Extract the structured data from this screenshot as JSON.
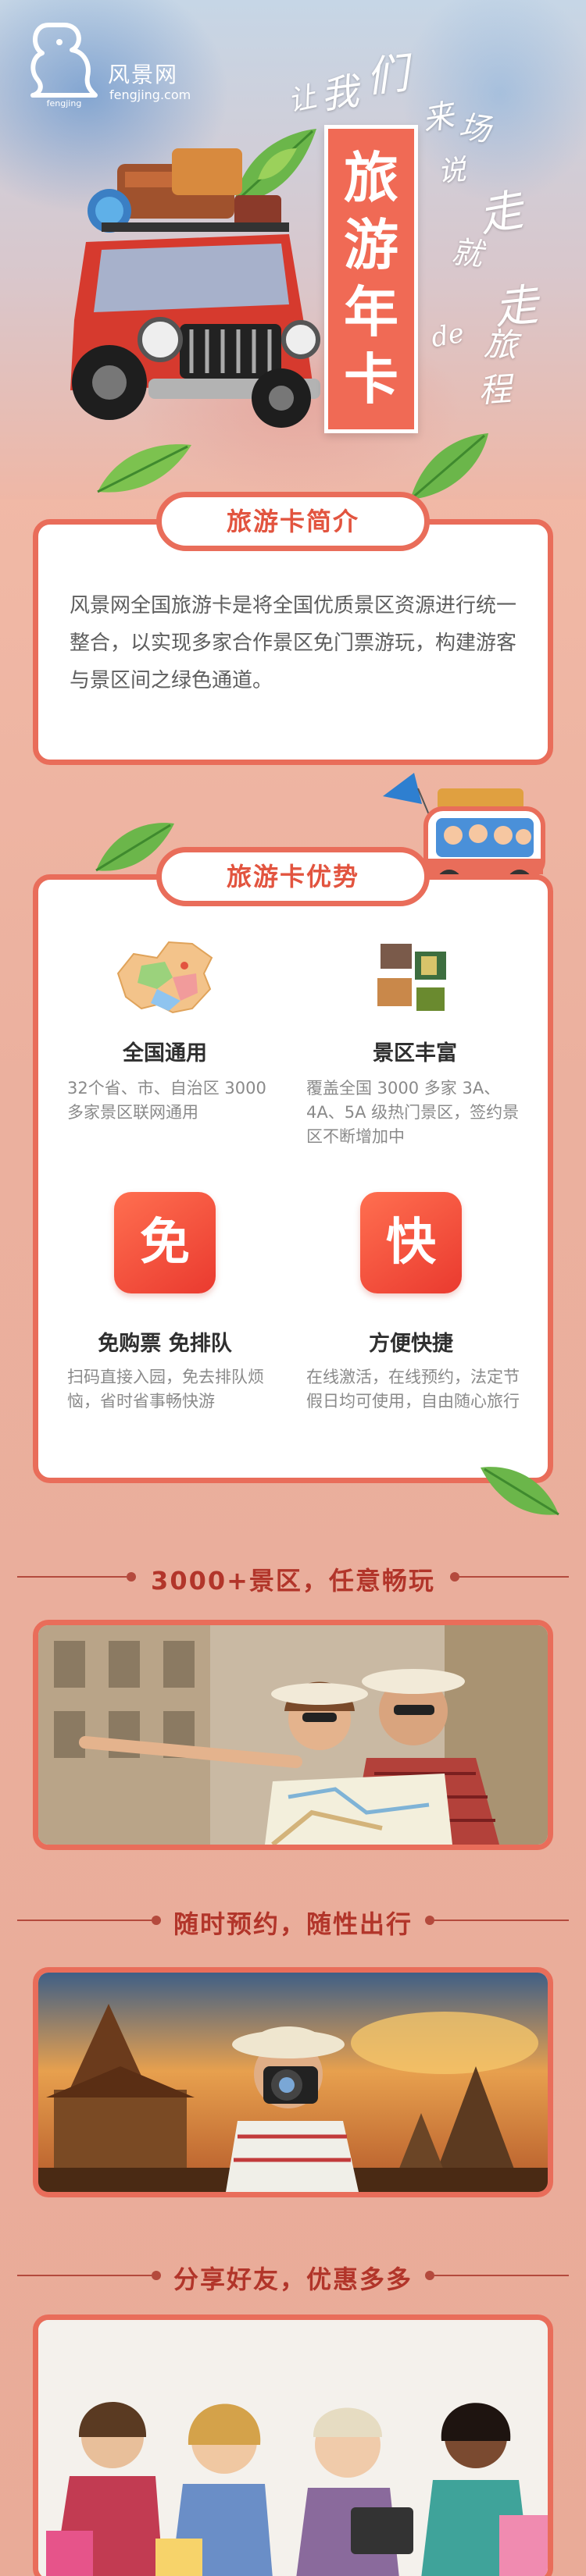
{
  "brand": {
    "name": "风景网",
    "url": "fengjing.com",
    "mark_text": "fengjing"
  },
  "hero": {
    "banner_chars": [
      "旅",
      "游",
      "年",
      "卡"
    ],
    "slogan_chars": [
      "让",
      "我",
      "们",
      "来",
      "场",
      "说",
      "走",
      "就",
      "走",
      "de",
      "旅",
      "程"
    ]
  },
  "intro": {
    "title": "旅游卡简介",
    "text": "风景网全国旅游卡是将全国优质景区资源进行统一整合，以实现多家合作景区免门票游玩，构建游客与景区间之绿色通道。"
  },
  "advantages": {
    "title": "旅游卡优势",
    "items": [
      {
        "title": "全国通用",
        "desc": "32个省、市、自治区 3000多家景区联网通用",
        "icon": "china-map-icon"
      },
      {
        "title": "景区丰富",
        "desc": "覆盖全国 3000 多家 3A、4A、5A 级热门景区，签约景区不断增加中",
        "icon": "photo-collage-icon"
      },
      {
        "title": "免购票 免排队",
        "desc": "扫码直接入园，免去排队烦恼，省时省事畅快游",
        "icon": "free-badge-icon",
        "badge": "免"
      },
      {
        "title": "方便快捷",
        "desc": "在线激活，在线预约，法定节假日均可使用，自由随心旅行",
        "icon": "fast-badge-icon",
        "badge": "快"
      }
    ]
  },
  "sections": [
    {
      "title": "3000+景区，任意畅玩",
      "image": "couple-with-map-photo"
    },
    {
      "title": "随时预约，随性出行",
      "image": "photographer-at-temple-photo"
    },
    {
      "title": "分享好友，优惠多多",
      "image": "friends-shopping-photo"
    }
  ],
  "colors": {
    "accent": "#e96d5a",
    "accent_dark": "#b2352a",
    "banner": "#f06a55",
    "background": "#ebb09e",
    "text": "#5e5e5e"
  }
}
